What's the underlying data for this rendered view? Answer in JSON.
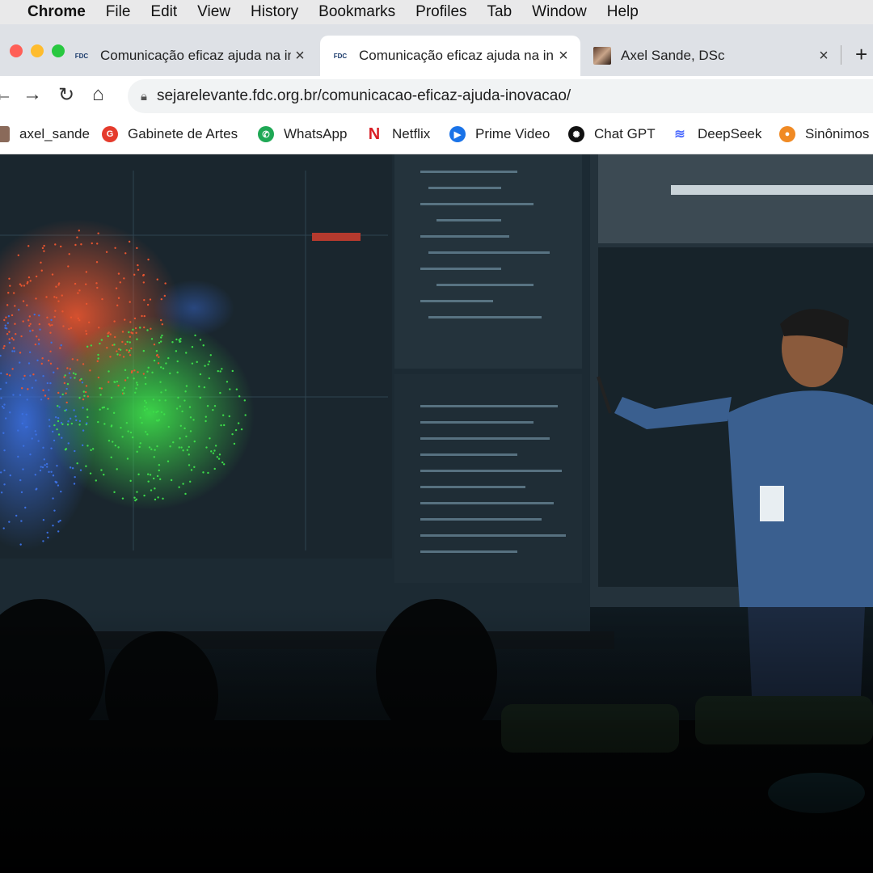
{
  "menubar": {
    "items": [
      "Chrome",
      "File",
      "Edit",
      "View",
      "History",
      "Bookmarks",
      "Profiles",
      "Tab",
      "Window",
      "Help"
    ]
  },
  "tabs": [
    {
      "favicon": "FDC",
      "title": "Comunicação eficaz ajuda na in",
      "active": false
    },
    {
      "favicon": "FDC",
      "title": "Comunicação eficaz ajuda na in",
      "active": true
    },
    {
      "favicon": "",
      "title": "Axel Sande, DSc",
      "active": false
    }
  ],
  "address": {
    "url": "sejarelevante.fdc.org.br/comunicacao-eficaz-ajuda-inovacao/"
  },
  "bookmarks": [
    {
      "label": "axel_sande",
      "icon": "profile-photo-icon",
      "color": "#8a6a5a"
    },
    {
      "label": "Gabinete de Artes",
      "icon": "g-icon",
      "color": "#e53b2c"
    },
    {
      "label": "WhatsApp",
      "icon": "whatsapp-icon",
      "color": "#1fa855"
    },
    {
      "label": "Netflix",
      "icon": "netflix-icon",
      "color": "#d81f26"
    },
    {
      "label": "Prime Video",
      "icon": "play-icon",
      "color": "#1a73e8"
    },
    {
      "label": "Chat GPT",
      "icon": "chatgpt-icon",
      "color": "#111111"
    },
    {
      "label": "DeepSeek",
      "icon": "whale-icon",
      "color": "#4d6bfe"
    },
    {
      "label": "Sinônimos",
      "icon": "sinonimos-icon",
      "color": "#f08a24"
    }
  ],
  "colors": {
    "menubar": "#e9e9ea",
    "tabbar": "#dee1e6",
    "scatter_red": "#e8552f",
    "scatter_green": "#3ddc4a",
    "scatter_blue": "#3b6fe0"
  }
}
